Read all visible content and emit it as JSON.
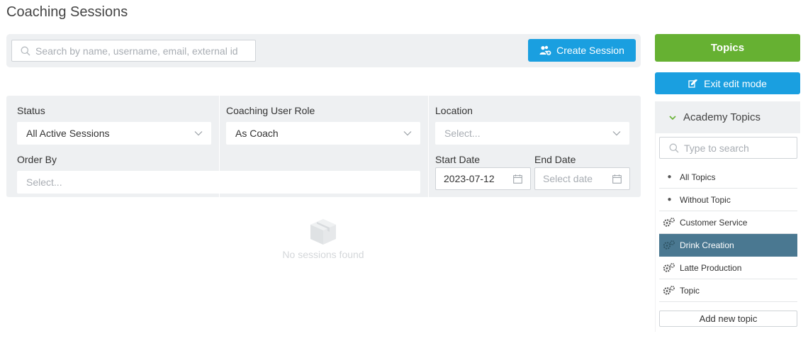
{
  "page": {
    "title": "Coaching Sessions"
  },
  "search": {
    "placeholder": "Search by name, username, email, external id",
    "value": ""
  },
  "toolbar": {
    "create_label": "Create Session"
  },
  "filters": {
    "status": {
      "label": "Status",
      "value": "All Active Sessions"
    },
    "role": {
      "label": "Coaching User Role",
      "value": "As Coach"
    },
    "location": {
      "label": "Location",
      "placeholder": "Select..."
    },
    "order_by": {
      "label": "Order By",
      "placeholder": "Select..."
    },
    "start_date": {
      "label": "Start Date",
      "value": "2023-07-12"
    },
    "end_date": {
      "label": "End Date",
      "placeholder": "Select date"
    }
  },
  "empty": {
    "text": "No sessions found"
  },
  "side": {
    "topics_label": "Topics",
    "exit_label": "Exit edit mode",
    "academy_label": "Academy Topics",
    "topic_search_placeholder": "Type to search",
    "items": [
      {
        "label": "All Topics",
        "icon": "bullet"
      },
      {
        "label": "Without Topic",
        "icon": "bullet"
      },
      {
        "label": "Customer Service",
        "icon": "gears-icon"
      },
      {
        "label": "Drink Creation",
        "icon": "gears-icon",
        "active": true
      },
      {
        "label": "Latte Production",
        "icon": "gears-icon"
      },
      {
        "label": "Topic",
        "icon": "gears-icon"
      }
    ],
    "add_label": "Add new topic"
  },
  "colors": {
    "primary": "#1a9fe0",
    "success": "#66b132",
    "active_topic": "#4a7891",
    "panel_bg": "#eef0f2"
  }
}
